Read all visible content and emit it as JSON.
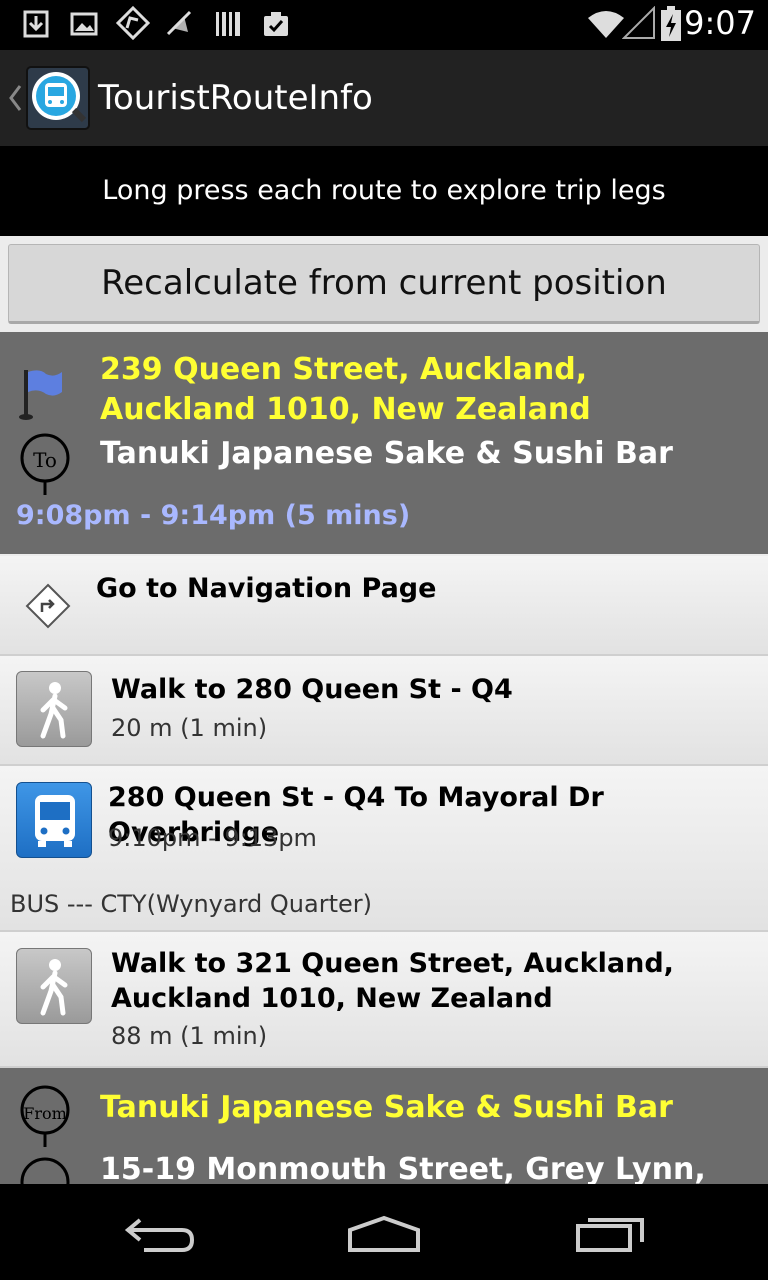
{
  "status_bar": {
    "time": "9:07",
    "notification_icons": [
      "download-icon",
      "image-icon",
      "map-route-icon",
      "no-location-icon",
      "barcode-icon",
      "clipboard-check-icon"
    ],
    "system_icons": [
      "wifi-icon",
      "signal-icon",
      "battery-icon"
    ]
  },
  "action_bar": {
    "app_title": "TouristRouteInfo",
    "app_icon": "bus-app-icon",
    "back_icon": "chevron-left-icon"
  },
  "hint": "Long press each route to explore trip legs",
  "recalculate_label": "Recalculate from current position",
  "route1": {
    "from_address": "239 Queen Street, Auckland, Auckland 1010, New Zealand",
    "to_place": "Tanuki Japanese Sake & Sushi Bar",
    "to_badge": "To",
    "time_range": "9:08pm - 9:14pm (5 mins)"
  },
  "navigation_row": {
    "label": "Go to Navigation Page",
    "icon": "turn-right-sign-icon"
  },
  "legs": [
    {
      "type": "walk",
      "icon": "walk-icon",
      "title": "Walk to 280 Queen St - Q4",
      "detail": "20 m (1 min)"
    },
    {
      "type": "bus",
      "icon": "bus-icon",
      "title": "280 Queen St - Q4 To Mayoral Dr Overbridge",
      "detail": "9:10pm - 9:13pm",
      "note": "BUS --- CTY(Wynyard Quarter)"
    },
    {
      "type": "walk",
      "icon": "walk-icon",
      "title": "Walk to 321 Queen Street, Auckland, Auckland 1010, New Zealand",
      "detail": "88 m (1 min)"
    }
  ],
  "route2": {
    "from_badge": "From",
    "from_place": "Tanuki Japanese Sake & Sushi Bar",
    "to_address": "15-19 Monmouth Street, Grey Lynn,"
  },
  "colors": {
    "header_gray": "#6c6c6c",
    "address_yellow": "#ffff33",
    "time_blue": "#a9b8ff",
    "bus_blue": "#1e6fc4"
  }
}
